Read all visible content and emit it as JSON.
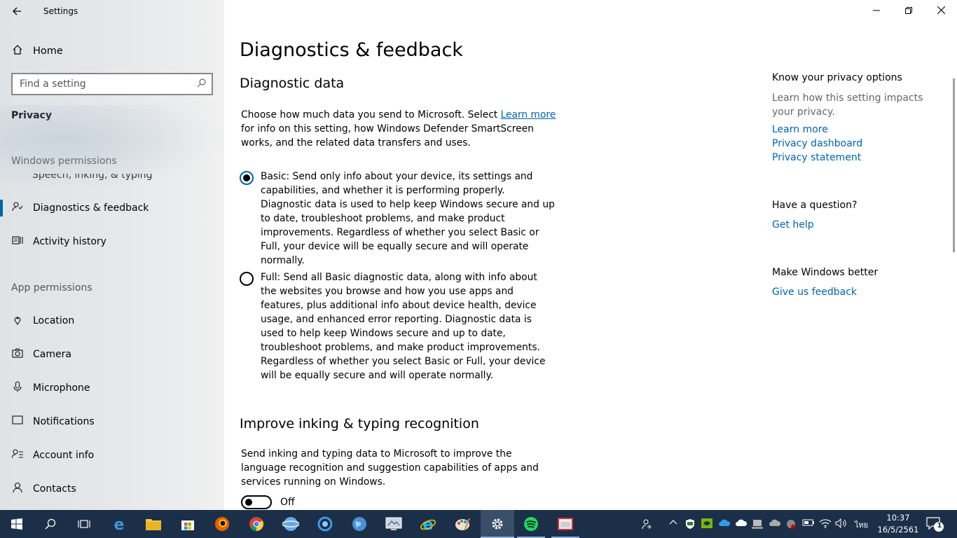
{
  "window": {
    "title": "Settings"
  },
  "sidebar": {
    "home": "Home",
    "search_placeholder": "Find a setting",
    "category": "Privacy",
    "windows_permissions_header": "Windows permissions",
    "partial_item": "Speech, inking, & typing",
    "windows_items": [
      {
        "label": "Diagnostics & feedback",
        "icon": "diagnostics-icon",
        "active": true
      },
      {
        "label": "Activity history",
        "icon": "activity-history-icon",
        "active": false
      }
    ],
    "app_permissions_header": "App permissions",
    "app_items": [
      {
        "label": "Location",
        "icon": "location-icon"
      },
      {
        "label": "Camera",
        "icon": "camera-icon"
      },
      {
        "label": "Microphone",
        "icon": "microphone-icon"
      },
      {
        "label": "Notifications",
        "icon": "notifications-icon"
      },
      {
        "label": "Account info",
        "icon": "account-info-icon"
      },
      {
        "label": "Contacts",
        "icon": "contacts-icon"
      }
    ]
  },
  "main": {
    "page_title": "Diagnostics & feedback",
    "diagnostic_section": {
      "title": "Diagnostic data",
      "intro_before_link": "Choose how much data you send to Microsoft. Select ",
      "intro_link": "Learn more",
      "intro_after_link": " for info on this setting, how Windows Defender SmartScreen works, and the related data transfers and uses.",
      "options": [
        {
          "label": "Basic: Send only info about your device, its settings and capabilities, and whether it is performing properly. Diagnostic data is used to help keep Windows secure and up to date, troubleshoot problems, and make product improvements. Regardless of whether you select Basic or Full, your device will be equally secure and will operate normally.",
          "selected": true
        },
        {
          "label": "Full: Send all Basic diagnostic data, along with info about the websites you browse and how you use apps and features, plus additional info about device health, device usage, and enhanced error reporting. Diagnostic data is used to help keep Windows secure and up to date, troubleshoot problems, and make product improvements. Regardless of whether you select Basic or Full, your device will be equally secure and will operate normally.",
          "selected": false
        }
      ]
    },
    "inking_section": {
      "title": "Improve inking & typing recognition",
      "description": "Send inking and typing data to Microsoft to improve the language recognition and suggestion capabilities of apps and services running on Windows.",
      "toggle_state": "Off"
    }
  },
  "right_panel": {
    "privacy_title": "Know your privacy options",
    "privacy_text": "Learn how this setting impacts your privacy.",
    "privacy_links": [
      "Learn more",
      "Privacy dashboard",
      "Privacy statement"
    ],
    "question_title": "Have a question?",
    "question_link": "Get help",
    "better_title": "Make Windows better",
    "better_link": "Give us feedback"
  },
  "taskbar": {
    "language": "ไทย",
    "time": "10:37",
    "date": "16/5/2561",
    "notification_count": "1"
  },
  "colors": {
    "accent": "#0063b1",
    "taskbar": "#1c2f48"
  }
}
